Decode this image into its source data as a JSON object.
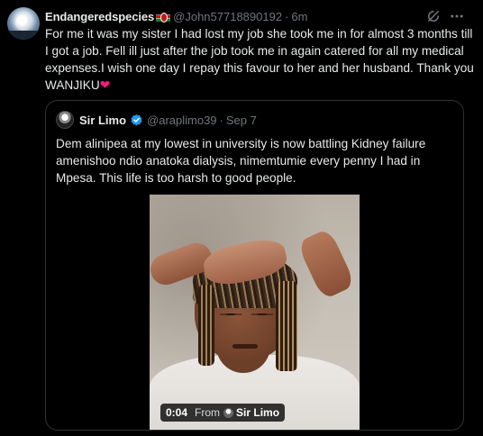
{
  "tweet": {
    "display_name": "Endangeredspecies",
    "handle": "@John57718890192",
    "separator": "·",
    "time": "6m",
    "text": "For me it was my sister I had lost my job she took me in for almost 3 months till I got a job. Fell ill just after the job took me in again catered for all my medical  expenses.I wish one day I repay this favour to her and her husband. Thank you WANJIKU",
    "emoji": "❤"
  },
  "quote": {
    "display_name": "Sir Limo",
    "handle": "@araplimo39",
    "separator": "·",
    "date": "Sep 7",
    "text": "Dem alinipea at my lowest in university is now battling Kidney failure amenishoo ndio anatoka dialysis, nimemtumie every penny I had in Mpesa. This life is too harsh to good people.",
    "video": {
      "duration": "0:04",
      "from_label": "From",
      "from_name": "Sir Limo"
    }
  },
  "colors": {
    "background": "#000000",
    "text_primary": "#e7e9ea",
    "text_secondary": "#71767b",
    "border": "#2f3336",
    "verified_blue": "#1d9bf0",
    "heart": "#f91880"
  },
  "icons": {
    "grok": "grok-icon",
    "more": "more-icon",
    "verified": "verified-badge-icon"
  }
}
